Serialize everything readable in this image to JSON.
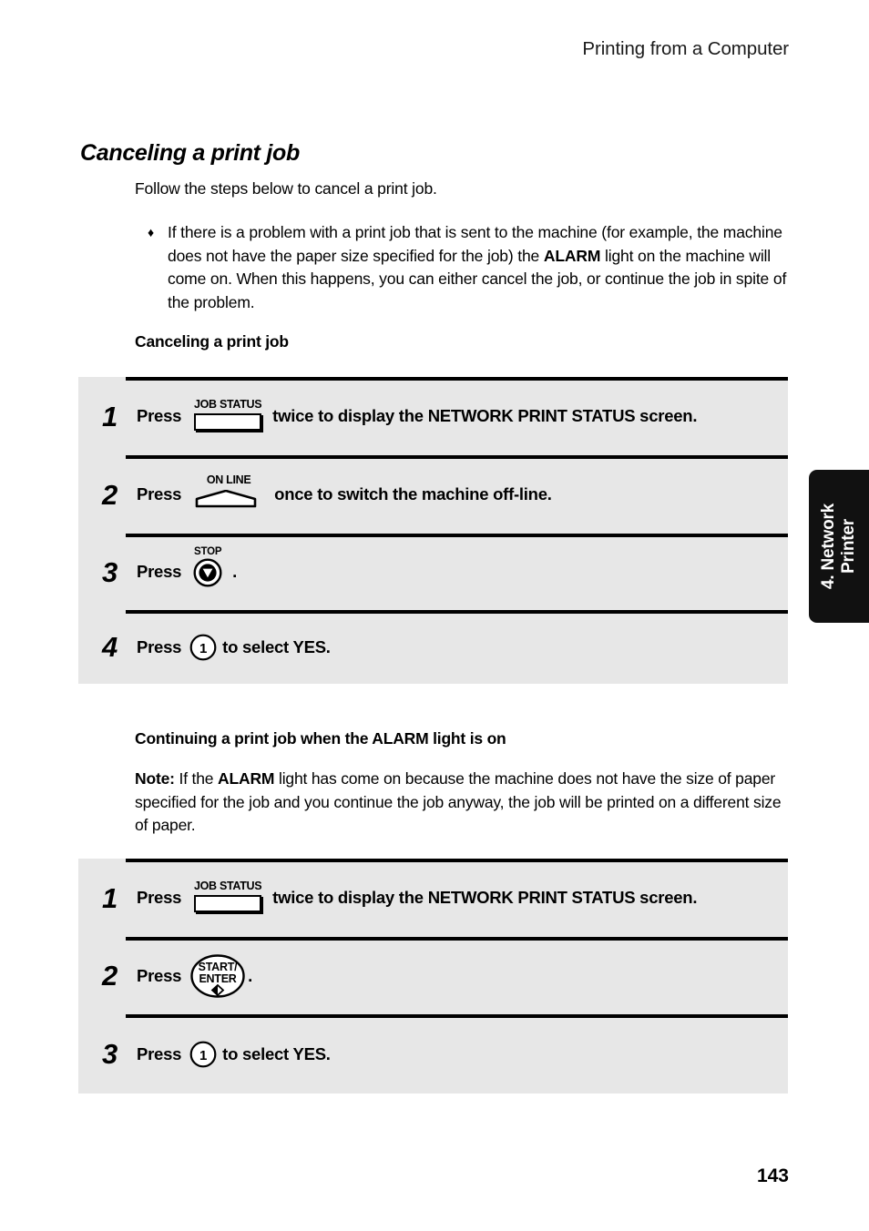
{
  "header": {
    "running_head": "Printing from a Computer"
  },
  "section": {
    "title": "Canceling a print job",
    "intro": "Follow the steps below to cancel a print job.",
    "bullet_glyph": "♦",
    "bullet": {
      "part1": "If there is a problem with a print job that is sent to the machine (for example, the machine does not have the paper size specified for the job) the ",
      "emph1": "ALARM",
      "part2": " light on the machine will come on. When this happens, you can either cancel the job, or continue the job in spite of the problem."
    }
  },
  "procedure_one": {
    "heading": "Canceling a print job",
    "steps": [
      {
        "number": "1",
        "press_label": "Press",
        "key": "job-status-key",
        "key_label": "JOB STATUS",
        "tail": "twice to display the NETWORK PRINT STATUS screen."
      },
      {
        "number": "2",
        "press_label": "Press",
        "key": "on-line-key",
        "key_label": "ON LINE",
        "tail": "once to switch the machine off-line."
      },
      {
        "number": "3",
        "press_label": "Press",
        "key": "stop-key",
        "key_label": "STOP",
        "tail": "."
      },
      {
        "number": "4",
        "press_label": "Press",
        "key": "numeric-key-1",
        "key_label": "1",
        "tail": "to select YES."
      }
    ]
  },
  "procedure_two": {
    "heading": "Continuing a print job when the ALARM light is on",
    "note": {
      "label": "Note:",
      "part1": " If the ",
      "emph1": "ALARM",
      "part2": " light has come on because the machine does not have the size of paper specified for the job and you continue the job anyway, the job will be printed on a different size of paper."
    },
    "steps": [
      {
        "number": "1",
        "press_label": "Press",
        "key": "job-status-key",
        "key_label": "JOB STATUS",
        "tail": "twice to display the NETWORK PRINT STATUS screen."
      },
      {
        "number": "2",
        "press_label": "Press",
        "key": "start-enter-key",
        "key_label_line1": "START/",
        "key_label_line2": "ENTER",
        "tail": "."
      },
      {
        "number": "3",
        "press_label": "Press",
        "key": "numeric-key-1",
        "key_label": "1",
        "tail": "to select YES."
      }
    ]
  },
  "side_tab": {
    "label_line1": "4. Network",
    "label_line2": "Printer"
  },
  "footer": {
    "page_number": "143"
  },
  "colors": {
    "box_background": "#e7e7e7",
    "rule": "#000000",
    "side_tab_background": "#111111",
    "side_tab_text": "#ffffff"
  }
}
